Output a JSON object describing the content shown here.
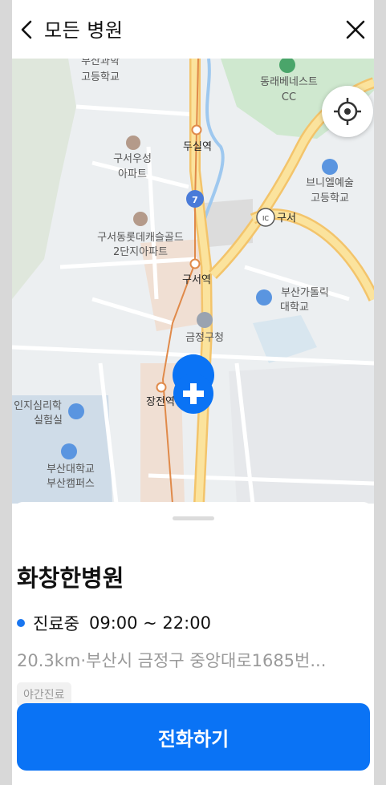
{
  "header": {
    "title": "모든 병원"
  },
  "map": {
    "labels": {
      "school1": "부산과학",
      "school1b": "고등학교",
      "cc": "동래베네스트",
      "cc2": "CC",
      "apt1": "구서우성",
      "apt1b": "아파트",
      "station1": "두실역",
      "school2": "브니엘예술",
      "school2b": "고등학교",
      "ic": "구서",
      "route": "7",
      "apt2": "구서동롯데캐슬골드",
      "apt2b": "2단지아파트",
      "station2": "구서역",
      "univ1": "부산가톨릭",
      "univ1b": "대학교",
      "office": "금정구청",
      "station3": "장전역",
      "lab1": "인지심리학",
      "lab1b": "실험실",
      "univ2": "부산대학교",
      "univ2b": "부산캠퍼스",
      "ic_badge": "IC"
    }
  },
  "hospital": {
    "name": "화창한병원",
    "status": "진료중",
    "hours": "09:00 ~ 22:00",
    "address": "20.3km·부산시 금정구 중앙대로1685번...",
    "tag": "야간진료"
  },
  "actions": {
    "call_label": "전화하기"
  },
  "colors": {
    "accent": "#0a73f5",
    "status_dot": "#1976f0",
    "road_main": "#f3c46b",
    "subway": "#e08a4a"
  }
}
